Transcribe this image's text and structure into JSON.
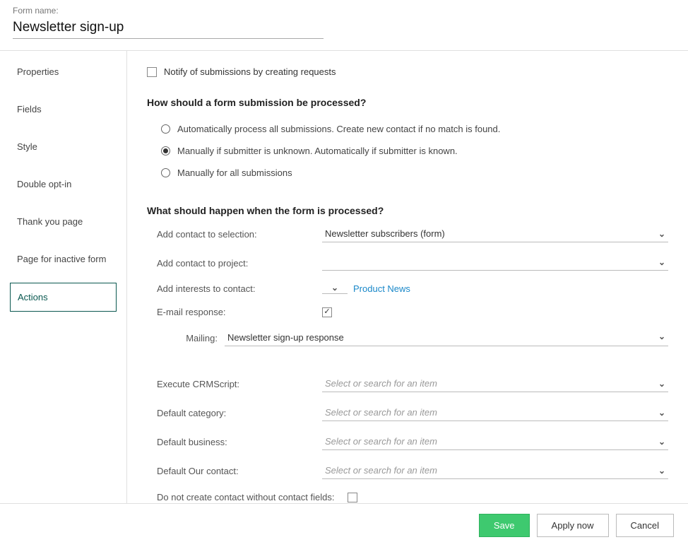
{
  "header": {
    "label": "Form name:",
    "value": "Newsletter sign-up"
  },
  "tabs": [
    {
      "label": "Properties"
    },
    {
      "label": "Fields"
    },
    {
      "label": "Style"
    },
    {
      "label": "Double opt-in"
    },
    {
      "label": "Thank you page"
    },
    {
      "label": "Page for inactive form"
    },
    {
      "label": "Actions"
    }
  ],
  "notify": {
    "label": "Notify of submissions by creating requests",
    "checked": false
  },
  "section1": {
    "title": "How should a form submission be processed?",
    "options": [
      {
        "label": "Automatically process all submissions. Create new contact if no match is found."
      },
      {
        "label": "Manually if submitter is unknown. Automatically if submitter is known."
      },
      {
        "label": "Manually for all submissions"
      }
    ],
    "selected": 1
  },
  "section2": {
    "title": "What should happen when the form is processed?",
    "add_selection": {
      "label": "Add contact to selection:",
      "value": "Newsletter subscribers (form)"
    },
    "add_project": {
      "label": "Add contact to project:",
      "value": ""
    },
    "add_interests": {
      "label": "Add interests to contact:",
      "value": "Product News"
    },
    "email_response": {
      "label": "E-mail response:",
      "checked": true
    },
    "mailing": {
      "label": "Mailing:",
      "value": "Newsletter sign-up response"
    },
    "execute_crm": {
      "label": "Execute CRMScript:",
      "placeholder": "Select or search for an item"
    },
    "default_cat": {
      "label": "Default category:",
      "placeholder": "Select or search for an item"
    },
    "default_bus": {
      "label": "Default business:",
      "placeholder": "Select or search for an item"
    },
    "default_our": {
      "label": "Default Our contact:",
      "placeholder": "Select or search for an item"
    },
    "no_create": {
      "label": "Do not create contact without contact fields:",
      "checked": false
    }
  },
  "footer": {
    "save": "Save",
    "apply": "Apply now",
    "cancel": "Cancel"
  }
}
